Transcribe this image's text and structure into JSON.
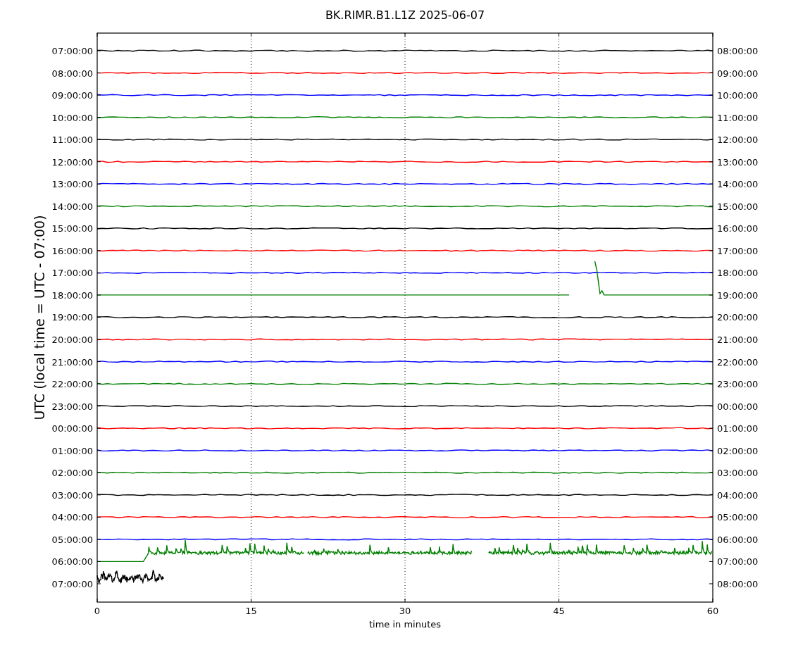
{
  "title": "BK.RIMR.B1.L1Z 2025-06-07",
  "ylabel": "UTC (local time = UTC - 07:00)",
  "xlabel": "time in minutes",
  "xticks": [
    "0",
    "15",
    "30",
    "45",
    "60"
  ],
  "rows": [
    {
      "left": "07:00:00",
      "right": "08:00:00",
      "color": "#000000",
      "kind": "flat"
    },
    {
      "left": "08:00:00",
      "right": "09:00:00",
      "color": "#ff0000",
      "kind": "flat"
    },
    {
      "left": "09:00:00",
      "right": "10:00:00",
      "color": "#0000ff",
      "kind": "flat"
    },
    {
      "left": "10:00:00",
      "right": "11:00:00",
      "color": "#008000",
      "kind": "flat"
    },
    {
      "left": "11:00:00",
      "right": "12:00:00",
      "color": "#000000",
      "kind": "flat"
    },
    {
      "left": "12:00:00",
      "right": "13:00:00",
      "color": "#ff0000",
      "kind": "flat"
    },
    {
      "left": "13:00:00",
      "right": "14:00:00",
      "color": "#0000ff",
      "kind": "flat"
    },
    {
      "left": "14:00:00",
      "right": "15:00:00",
      "color": "#008000",
      "kind": "flat"
    },
    {
      "left": "15:00:00",
      "right": "16:00:00",
      "color": "#000000",
      "kind": "flat"
    },
    {
      "left": "16:00:00",
      "right": "17:00:00",
      "color": "#ff0000",
      "kind": "flat"
    },
    {
      "left": "17:00:00",
      "right": "18:00:00",
      "color": "#0000ff",
      "kind": "flat"
    },
    {
      "left": "18:00:00",
      "right": "19:00:00",
      "color": "#008000",
      "kind": "spike"
    },
    {
      "left": "19:00:00",
      "right": "20:00:00",
      "color": "#000000",
      "kind": "flat"
    },
    {
      "left": "20:00:00",
      "right": "21:00:00",
      "color": "#ff0000",
      "kind": "flat"
    },
    {
      "left": "21:00:00",
      "right": "22:00:00",
      "color": "#0000ff",
      "kind": "flat"
    },
    {
      "left": "22:00:00",
      "right": "23:00:00",
      "color": "#008000",
      "kind": "flat"
    },
    {
      "left": "23:00:00",
      "right": "00:00:00",
      "color": "#000000",
      "kind": "flat"
    },
    {
      "left": "00:00:00",
      "right": "01:00:00",
      "color": "#ff0000",
      "kind": "flat"
    },
    {
      "left": "01:00:00",
      "right": "02:00:00",
      "color": "#0000ff",
      "kind": "flat"
    },
    {
      "left": "02:00:00",
      "right": "03:00:00",
      "color": "#008000",
      "kind": "flat"
    },
    {
      "left": "03:00:00",
      "right": "04:00:00",
      "color": "#000000",
      "kind": "flat"
    },
    {
      "left": "04:00:00",
      "right": "05:00:00",
      "color": "#ff0000",
      "kind": "flat"
    },
    {
      "left": "05:00:00",
      "right": "06:00:00",
      "color": "#0000ff",
      "kind": "flat"
    },
    {
      "left": "06:00:00",
      "right": "07:00:00",
      "color": "#008000",
      "kind": "active"
    },
    {
      "left": "07:00:00",
      "right": "08:00:00",
      "color": "#000000",
      "kind": "partial"
    }
  ]
}
